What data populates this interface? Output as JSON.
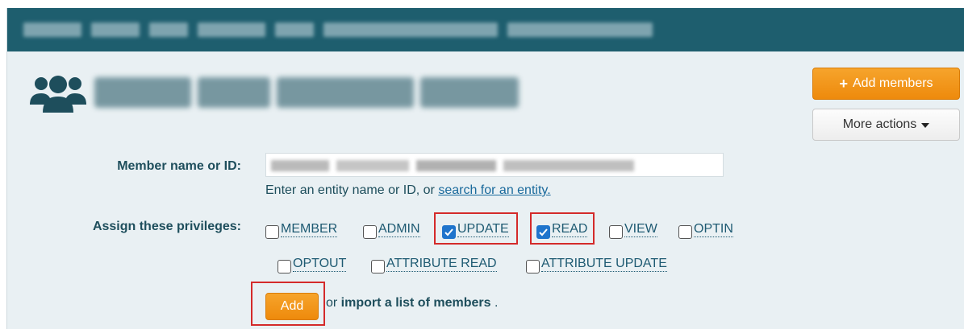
{
  "header": {
    "breadcrumb_blurred": true
  },
  "group": {
    "icon": "group-icon",
    "title_blurred": true
  },
  "actions": {
    "add_members_label": "Add members",
    "add_members_icon": "plus-icon",
    "more_actions_label": "More actions",
    "more_actions_icon": "caret-down-icon"
  },
  "form": {
    "member_label": "Member name or ID:",
    "member_value_blurred": true,
    "hint_prefix": "Enter an entity name or ID, or ",
    "hint_link": "search for an entity.",
    "privileges_label": "Assign these privileges:",
    "privileges": [
      {
        "label": "MEMBER",
        "checked": false,
        "highlighted": false
      },
      {
        "label": "ADMIN",
        "checked": false,
        "highlighted": false
      },
      {
        "label": "UPDATE",
        "checked": true,
        "highlighted": true
      },
      {
        "label": "READ",
        "checked": true,
        "highlighted": true
      },
      {
        "label": "VIEW",
        "checked": false,
        "highlighted": false
      },
      {
        "label": "OPTIN",
        "checked": false,
        "highlighted": false
      },
      {
        "label": "OPTOUT",
        "checked": false,
        "highlighted": false
      },
      {
        "label": "ATTRIBUTE READ",
        "checked": false,
        "highlighted": false
      },
      {
        "label": "ATTRIBUTE UPDATE",
        "checked": false,
        "highlighted": false
      }
    ],
    "add_button_label": "Add",
    "add_button_highlighted": true,
    "or_text": "or ",
    "import_link": "import a list of members",
    "trailing_period": "."
  },
  "colors": {
    "header": "#1e5e6e",
    "background": "#e9f0f3",
    "accent_orange": "#f39a1d",
    "label_text": "#1e4e5c",
    "link_text": "#1a6a9c",
    "checkbox_checked": "#1f74cc",
    "highlight_red": "#d42a2a"
  }
}
